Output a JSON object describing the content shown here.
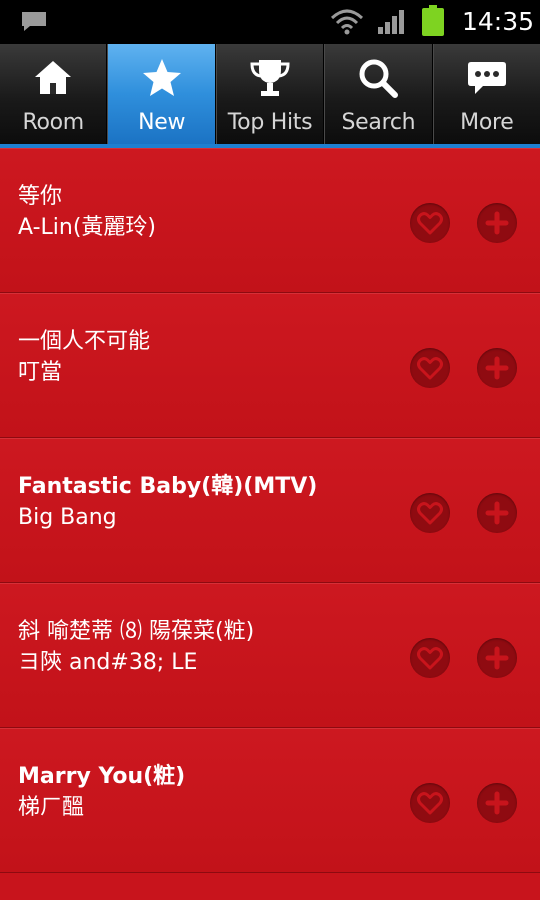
{
  "status_bar": {
    "time": "14:35",
    "icons": [
      "notification-icon",
      "wifi-icon",
      "signal-icon",
      "battery-icon"
    ],
    "battery_color": "#7ed321"
  },
  "tabs": [
    {
      "label": "Room",
      "icon": "home-icon",
      "active": false
    },
    {
      "label": "New",
      "icon": "star-icon",
      "active": true
    },
    {
      "label": "Top Hits",
      "icon": "trophy-icon",
      "active": false
    },
    {
      "label": "Search",
      "icon": "search-icon",
      "active": false
    },
    {
      "label": "More",
      "icon": "chat-bubble-icon",
      "active": false
    }
  ],
  "songs": [
    {
      "title": "等你",
      "artist": "A-Lin(黃麗玲)",
      "bold": false
    },
    {
      "title": "一個人不可能",
      "artist": "叮當",
      "bold": false
    },
    {
      "title": "Fantastic Baby(韓)(MTV)",
      "artist": "Big Bang",
      "bold": true
    },
    {
      "title": "斜 喻楚蒂 ⑻ 陽葆菜(粧)",
      "artist": "ヨ陝 and#38; LE",
      "bold": false
    },
    {
      "title": "Marry You(粧)",
      "artist": "梯ㄏ醞",
      "bold": true
    }
  ],
  "row_actions": {
    "favorite_icon": "heart-icon",
    "add_icon": "plus-icon"
  },
  "colors": {
    "background": "#c8141c",
    "tab_active": "#2f8fdc",
    "button_circle": "#8f0b11"
  }
}
